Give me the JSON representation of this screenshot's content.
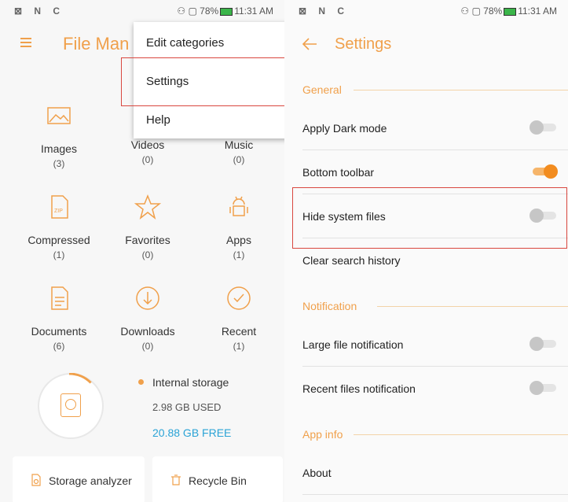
{
  "status_bar": {
    "left_icons": "⊠ N C",
    "right_text": "78%",
    "time": "11:31 AM"
  },
  "left": {
    "app_title": "File Man",
    "categories": [
      {
        "name": "Images",
        "count": "(3)",
        "icon": "image-icon"
      },
      {
        "name": "Videos",
        "count": "(0)",
        "icon": "video-icon"
      },
      {
        "name": "Music",
        "count": "(0)",
        "icon": "music-icon"
      },
      {
        "name": "Compressed",
        "count": "(1)",
        "icon": "zip-icon"
      },
      {
        "name": "Favorites",
        "count": "(0)",
        "icon": "star-icon"
      },
      {
        "name": "Apps",
        "count": "(1)",
        "icon": "android-icon"
      },
      {
        "name": "Documents",
        "count": "(6)",
        "icon": "document-icon"
      },
      {
        "name": "Downloads",
        "count": "(0)",
        "icon": "download-icon"
      },
      {
        "name": "Recent",
        "count": "(1)",
        "icon": "check-circle-icon"
      }
    ],
    "storage": {
      "name": "Internal storage",
      "used": "2.98 GB USED",
      "free": "20.88 GB FREE",
      "used_fraction": 0.125
    },
    "tools": {
      "analyzer": "Storage analyzer",
      "recycle": "Recycle Bin"
    },
    "menu": {
      "items": [
        "Edit categories",
        "Settings",
        "Help"
      ],
      "highlighted": "Settings"
    }
  },
  "right": {
    "title": "Settings",
    "sections": {
      "general": "General",
      "notification": "Notification",
      "app_info": "App info"
    },
    "rows": {
      "dark_mode": {
        "label": "Apply Dark mode",
        "on": false
      },
      "bottom_toolbar": {
        "label": "Bottom toolbar",
        "on": true
      },
      "hide_system": {
        "label": "Hide system files",
        "on": false
      },
      "clear_search": {
        "label": "Clear search history"
      },
      "large_file": {
        "label": "Large file notification",
        "on": false
      },
      "recent_files": {
        "label": "Recent files notification",
        "on": false
      },
      "about": {
        "label": "About"
      }
    }
  },
  "colors": {
    "accent": "#f0a04b",
    "highlight": "#d9473f",
    "free": "#2aa3d6"
  }
}
